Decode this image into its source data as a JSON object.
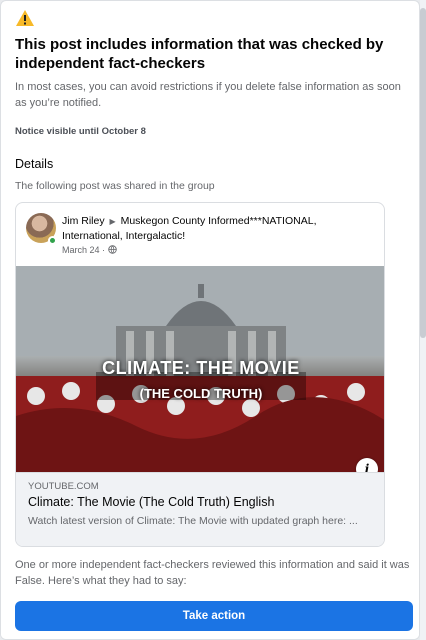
{
  "notice": {
    "title": "This post includes information that was checked by independent fact-checkers",
    "subtitle": "In most cases, you can avoid restrictions if you delete false information as soon as you’re notified.",
    "visible_until": "Notice visible until October 8"
  },
  "details": {
    "heading": "Details",
    "shared_text": "The following post was shared in the group"
  },
  "post": {
    "author": "Jim Riley",
    "group": "Muskegon County Informed***NATIONAL, International, Intergalactic!",
    "date": "March 24 ·",
    "image_title": "CLIMATE: THE MOVIE",
    "image_subtitle": "(THE COLD TRUTH)",
    "link_domain": "YOUTUBE.COM",
    "link_title": "Climate: The Movie (The Cold Truth) English",
    "link_description": "Watch latest version of Climate: The Movie with updated graph here: ..."
  },
  "review_text": "One or more independent fact-checkers reviewed this information and said it was False. Here’s what they had to say:",
  "action_label": "Take action",
  "colors": {
    "primary": "#1b74e4",
    "warning": "#f7b928",
    "online": "#31a24c"
  }
}
